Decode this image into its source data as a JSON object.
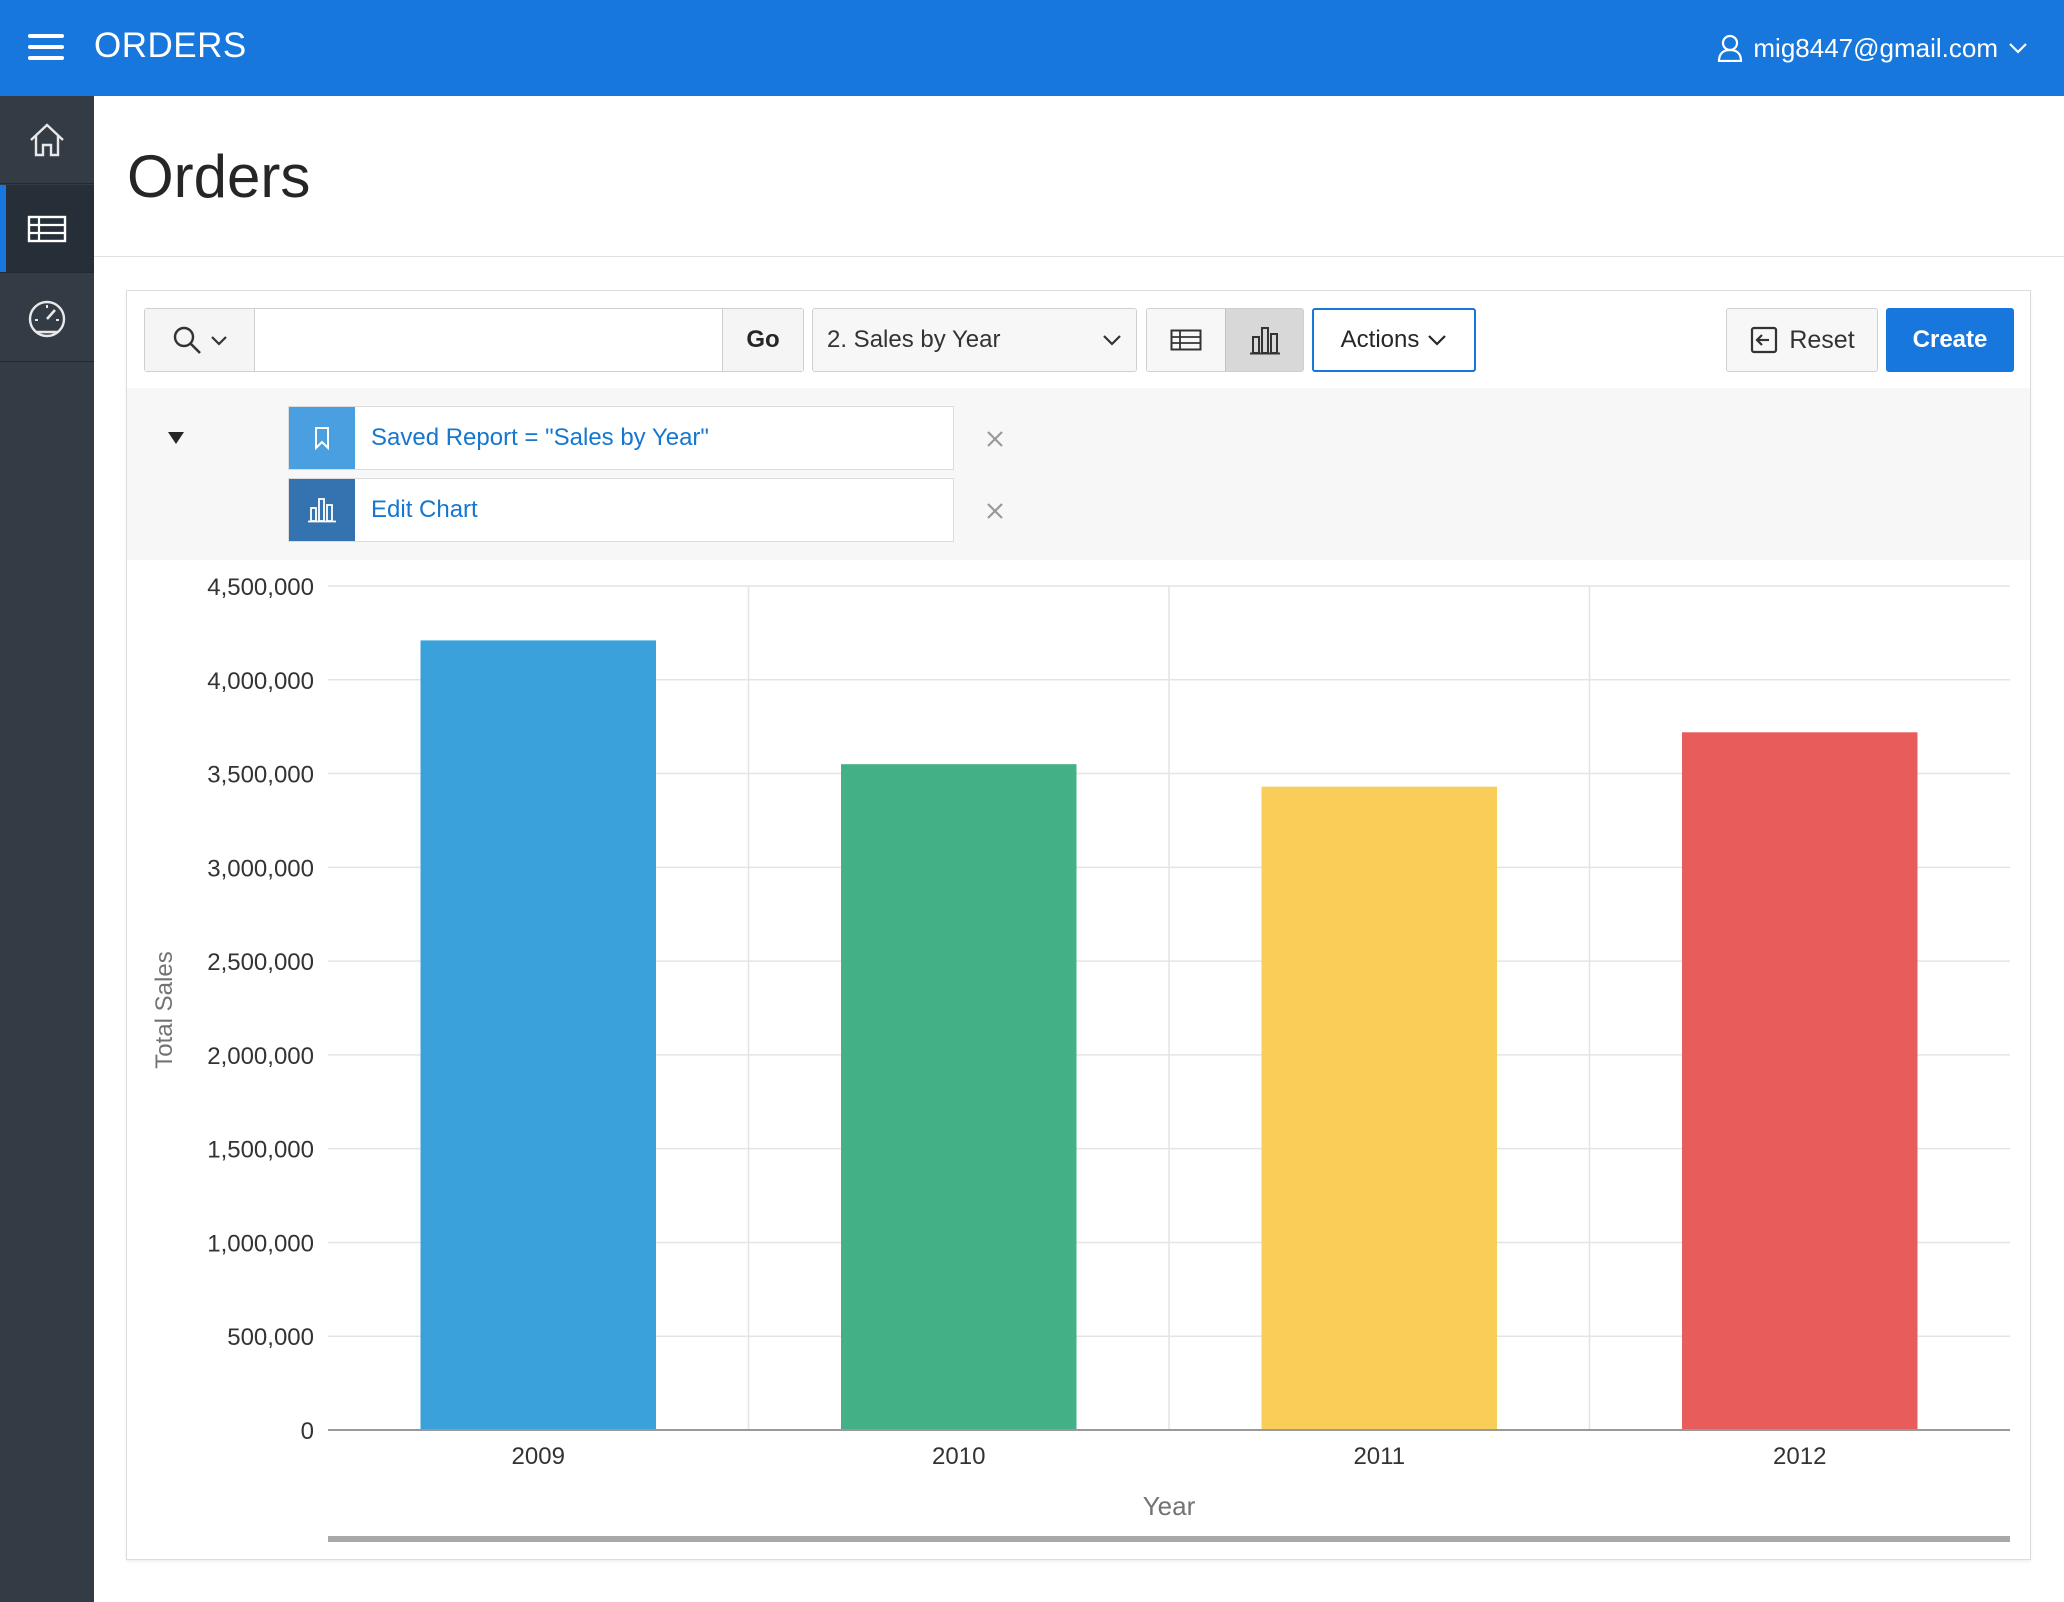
{
  "header": {
    "app_title": "ORDERS",
    "user": "mig8447@gmail.com",
    "brand_color": "#1777dd"
  },
  "sidebar": {
    "items": [
      {
        "name": "home",
        "icon": "home-icon",
        "active": false
      },
      {
        "name": "orders",
        "icon": "table-icon",
        "active": true
      },
      {
        "name": "dashboard",
        "icon": "dashboard-icon",
        "active": false
      }
    ]
  },
  "page": {
    "title": "Orders"
  },
  "toolbar": {
    "search_value": "",
    "go_label": "Go",
    "report_select_value": "2. Sales by Year",
    "actions_label": "Actions",
    "reset_label": "Reset",
    "create_label": "Create"
  },
  "filters": [
    {
      "icon": "bookmark-icon",
      "label": "Saved Report = \"Sales by Year\"",
      "icon_bg": "#4a9fe0"
    },
    {
      "icon": "bar-chart-icon",
      "label": "Edit Chart",
      "icon_bg": "#3572b0"
    }
  ],
  "chart_data": {
    "type": "bar",
    "categories": [
      "2009",
      "2010",
      "2011",
      "2012"
    ],
    "values": [
      4210000,
      3550000,
      3430000,
      3720000
    ],
    "colors": [
      "#3aa1da",
      "#43b086",
      "#f8cd58",
      "#e85d5c"
    ],
    "xlabel": "Year",
    "ylabel": "Total Sales",
    "ylim": [
      0,
      4500000
    ],
    "yticks": [
      "0",
      "500,000",
      "1,000,000",
      "1,500,000",
      "2,000,000",
      "2,500,000",
      "3,000,000",
      "3,500,000",
      "4,000,000",
      "4,500,000"
    ],
    "grid": true
  }
}
